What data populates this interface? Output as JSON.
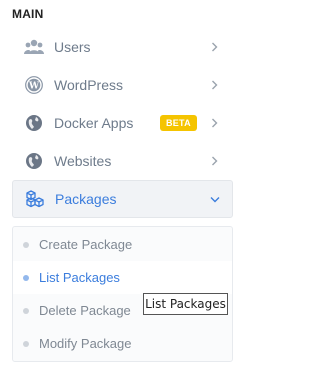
{
  "section": {
    "title": "MAIN"
  },
  "menu": [
    {
      "label": "Users",
      "icon": "users-icon"
    },
    {
      "label": "WordPress",
      "icon": "wordpress-icon"
    },
    {
      "label": "Docker Apps",
      "icon": "docker-globe-icon",
      "badge": "BETA"
    },
    {
      "label": "Websites",
      "icon": "globe-icon"
    },
    {
      "label": "Packages",
      "icon": "boxes-icon",
      "expanded": true
    }
  ],
  "submenu": [
    {
      "label": "Create Package"
    },
    {
      "label": "List Packages",
      "active": true
    },
    {
      "label": "Delete Package"
    },
    {
      "label": "Modify Package"
    }
  ],
  "tooltip": {
    "text": "List Packages"
  },
  "colors": {
    "accent": "#3b7ddd",
    "badge": "#f5c400",
    "text": "#6e7b8b"
  }
}
